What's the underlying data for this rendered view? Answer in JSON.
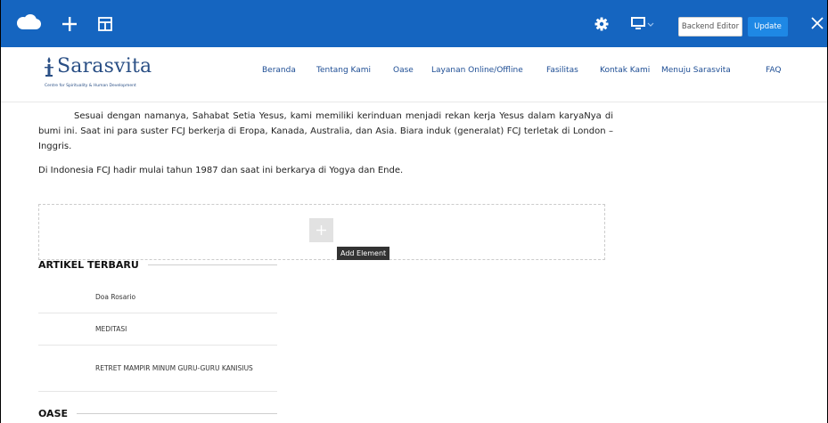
{
  "toolbar": {
    "logo_icon": "cloud-icon",
    "add_icon": "plus-icon",
    "layout_icon": "layout-icon",
    "settings_icon": "gear-icon",
    "device_icon": "monitor-icon",
    "backend_editor_label": "Backend Editor",
    "update_label": "Update",
    "close_icon": "close-icon",
    "bg_color": "#1565c0"
  },
  "site": {
    "logo_name": "Sarasvita",
    "logo_tagline": "Centre for Spirituality & Human Development",
    "nav": [
      "Beranda",
      "Tentang Kami",
      "Oase",
      "Layanan Online/Offline",
      "Fasilitas",
      "Kontak Kami",
      "Menuju Sarasvita",
      "FAQ"
    ]
  },
  "content": {
    "para1": "Sesuai dengan namanya, Sahabat Setia Yesus, kami memiliki kerinduan menjadi rekan kerja Yesus dalam karyaNya di bumi ini.  Saat ini para suster FCJ berkerja di Eropa, Kanada, Australia, dan Asia.  Biara induk (generalat) FCJ terletak di London – Inggris.",
    "para2": "Di Indonesia FCJ hadir mulai tahun 1987 dan saat ini berkarya di Yogya dan Ende.",
    "add_element_tooltip": "Add Element"
  },
  "sidebar": {
    "recent_title": "ARTIKEL TERBARU",
    "posts": [
      "Doa Rosario",
      "MEDITASI",
      "RETRET MAMPIR MINUM GURU-GURU KANISIUS"
    ],
    "oase_title": "OASE"
  }
}
